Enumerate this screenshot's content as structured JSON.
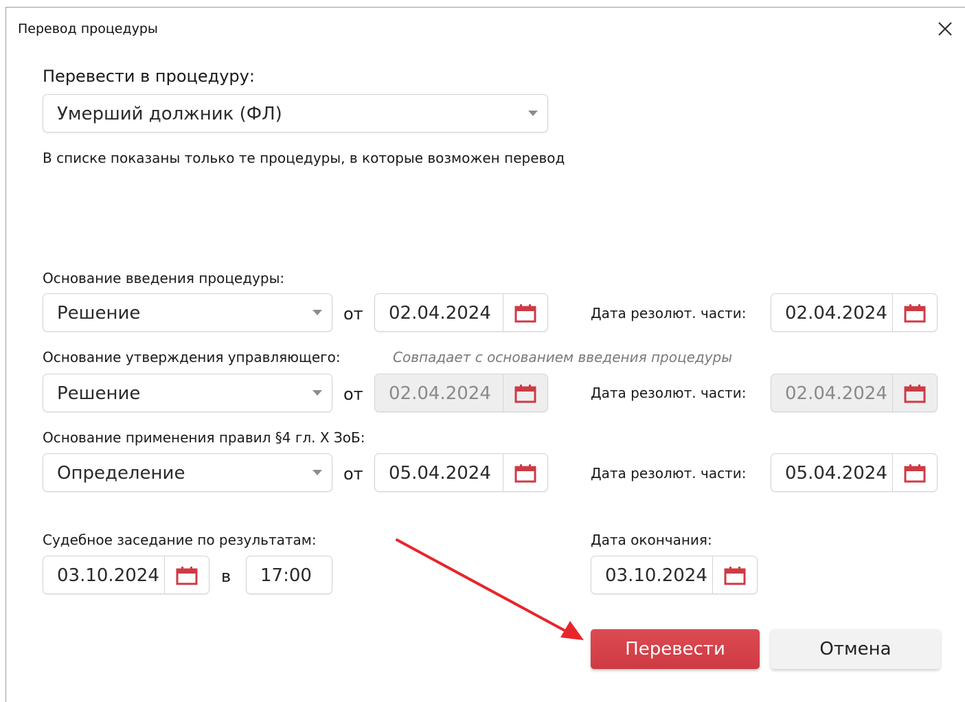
{
  "dialog": {
    "title": "Перевод процедуры"
  },
  "target": {
    "label": "Перевести в процедуру:",
    "value": "Умерший должник (ФЛ)",
    "hint": "В списке показаны только те процедуры, в которые возможен перевод"
  },
  "intro_basis": {
    "label": "Основание введения процедуры:",
    "type": "Решение",
    "from_label": "от",
    "date": "02.04.2024",
    "resolution_label": "Дата резолют. части:",
    "resolution_date": "02.04.2024"
  },
  "manager_basis": {
    "label": "Основание утверждения управляющего:",
    "note": "Совпадает с основанием введения процедуры",
    "type": "Решение",
    "from_label": "от",
    "date": "02.04.2024",
    "resolution_label": "Дата резолют. части:",
    "resolution_date": "02.04.2024"
  },
  "rules_basis": {
    "label": "Основание применения правил §4 гл. X ЗоБ:",
    "type": "Определение",
    "from_label": "от",
    "date": "05.04.2024",
    "resolution_label": "Дата резолют. части:",
    "resolution_date": "05.04.2024"
  },
  "hearing": {
    "label": "Судебное заседание по результатам:",
    "date": "03.10.2024",
    "at_label": "в",
    "time": "17:00"
  },
  "end_date": {
    "label": "Дата окончания:",
    "date": "03.10.2024"
  },
  "buttons": {
    "submit": "Перевести",
    "cancel": "Отмена"
  },
  "colors": {
    "accent": "#d4404a",
    "calendar": "#cc3b45",
    "annotation_arrow": "#e8252b"
  }
}
